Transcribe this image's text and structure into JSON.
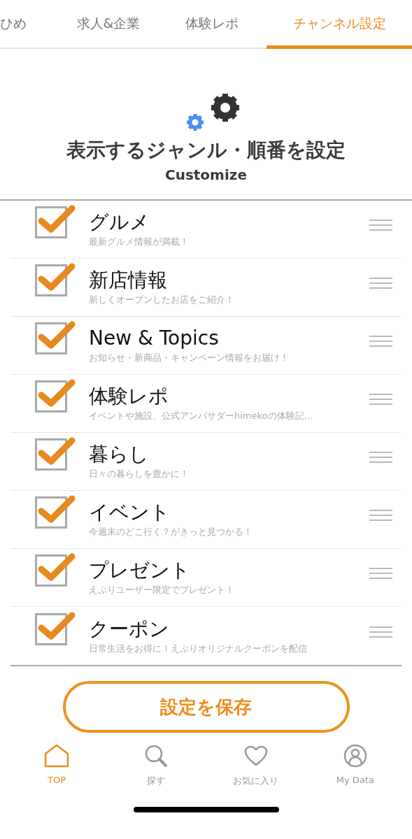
{
  "tabs": [
    {
      "label": "ひめ",
      "selected": false
    },
    {
      "label": "求人&企業",
      "selected": false
    },
    {
      "label": "体験レポ",
      "selected": false
    },
    {
      "label": "チャンネル設定",
      "selected": true
    }
  ],
  "header": {
    "title": "表示するジャンル・順番を設定",
    "subtitle": "Customize"
  },
  "genres": [
    {
      "name": "グルメ",
      "description": "最新グルメ情報が満載！",
      "checked": true
    },
    {
      "name": "新店情報",
      "description": "新しくオープンしたお店をご紹介！",
      "checked": true
    },
    {
      "name": "New & Topics",
      "description": "お知らせ・新商品・キャンペーン情報をお届け！",
      "checked": true
    },
    {
      "name": "体験レポ",
      "description": "イベントや施設、公式アンバサダーhimekoの体験記…",
      "checked": true
    },
    {
      "name": "暮らし",
      "description": "日々の暮らしを豊かに！",
      "checked": true
    },
    {
      "name": "イベント",
      "description": "今週末のどこ行く？がきっと見つかる！",
      "checked": true
    },
    {
      "name": "プレゼント",
      "description": "えぷりユーザー限定でプレゼント！",
      "checked": true
    },
    {
      "name": "クーポン",
      "description": "日常生活をお得に！えぷりオリジナルクーポンを配信",
      "checked": true
    }
  ],
  "save_button": {
    "label": "設定を保存"
  },
  "bottom_nav": [
    {
      "kind": "home",
      "label": "TOP",
      "selected": true
    },
    {
      "kind": "search",
      "label": "探す",
      "selected": false
    },
    {
      "kind": "favorite",
      "label": "お気に入り",
      "selected": false
    },
    {
      "kind": "profile",
      "label": "My Data",
      "selected": false
    }
  ]
}
